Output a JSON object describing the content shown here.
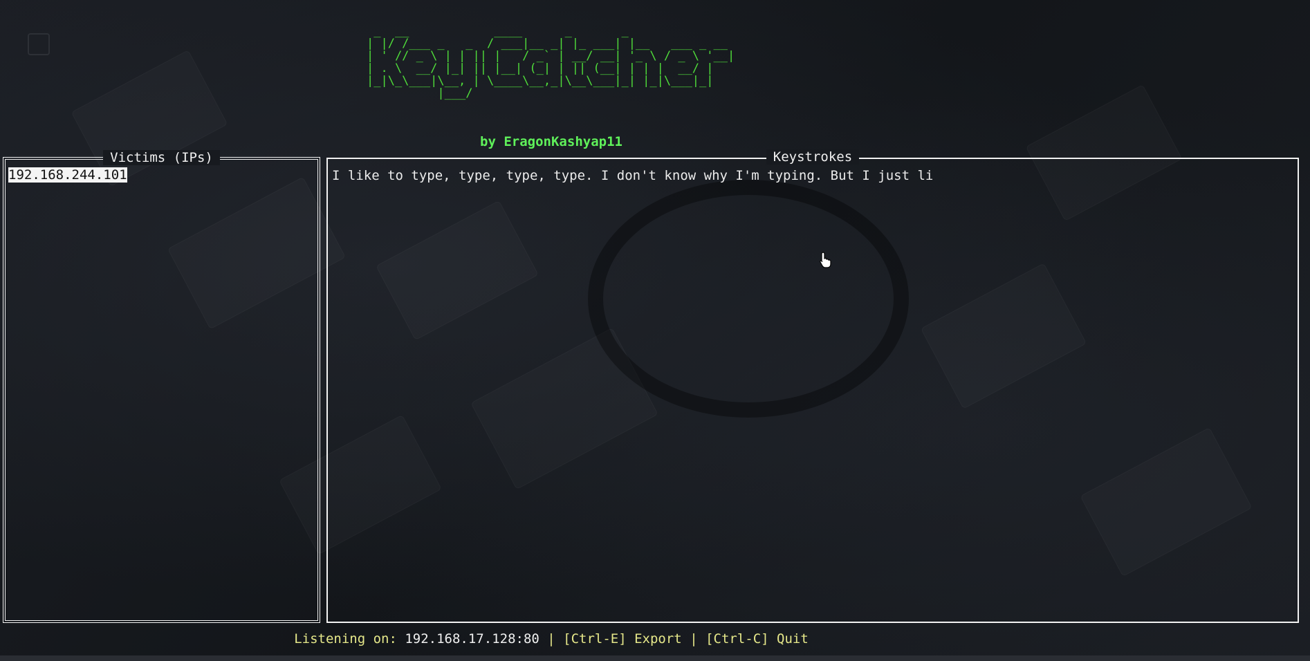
{
  "banner": {
    "ascii_art": " _  __            ____      _       _               \n| |/ /___ _   _  / ___|__ _| |_ ___| |__   ___ _ __ \n| ' // _ \\ | | || |   / _` | __/ __| '_ \\ / _ \\ '__|\n| . \\  __/ |_| || |__| (_| | || (__| | | |  __/ |   \n|_|\\_\\___|\\__, | \\____\\__,_|\\__\\___|_| |_|\\___|_|   \n          |___/                                    ",
    "author": "by EragonKashyap11",
    "color": "#4fdc3a"
  },
  "victims_panel": {
    "title": "Victims (IPs)",
    "items": [
      {
        "label": "192.168.244.101",
        "selected": true
      }
    ]
  },
  "keystrokes_panel": {
    "title": "Keystrokes",
    "text": "I like to type, type, type, type. I don't know why I'm typing. But I just li"
  },
  "status_bar": {
    "listening_label": "Listening on: ",
    "listening_address": "192.168.17.128:80",
    "separator": " | ",
    "export_shortcut": "[Ctrl-E] Export",
    "quit_shortcut": "[Ctrl-C] Quit",
    "accent_color": "#e6e88a"
  },
  "cursor": {
    "icon": "hand-pointer-icon"
  }
}
